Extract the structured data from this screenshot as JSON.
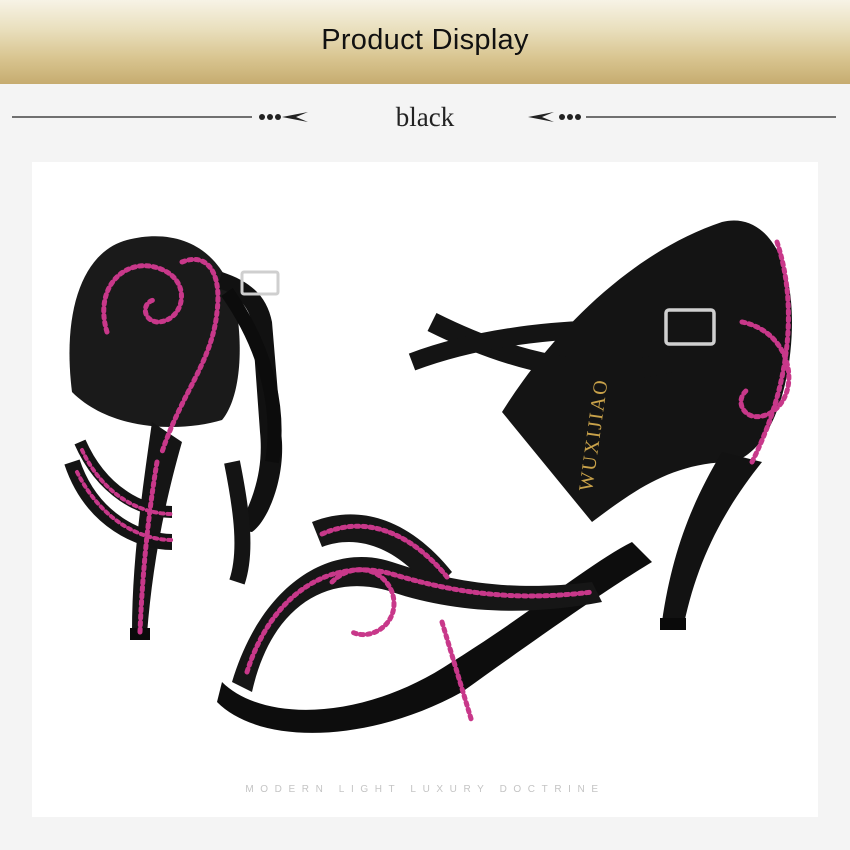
{
  "header": {
    "title": "Product Display"
  },
  "color_section": {
    "label": "black"
  },
  "product_photo": {
    "brand_text": "WUXIJIAO",
    "tagline": "MODERN LIGHT LUXURY DOCTRINE"
  },
  "colors": {
    "banner_gold": "#d8c48f",
    "shoe_black": "#141414",
    "rhinestone_pink": "#c8388a"
  }
}
